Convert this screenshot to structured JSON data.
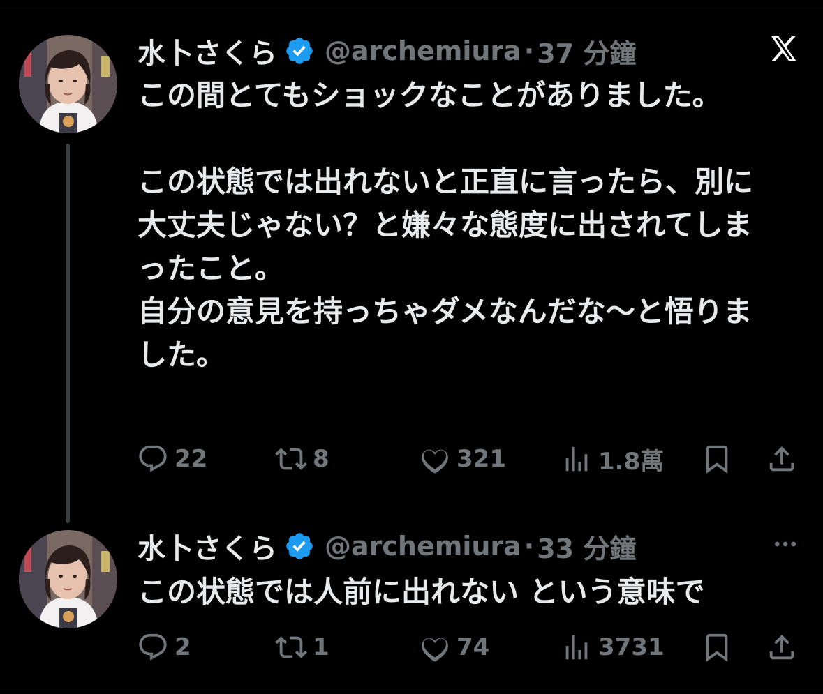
{
  "tweets": [
    {
      "author_name": "水卜さくら",
      "handle": "@archemiura",
      "separator": "·",
      "time": "37 分鐘",
      "text": "この間とてもショックなことがありました。\n\nこの状態では出れないと正直に言ったら、別に大丈夫じゃない？と嫌々な態度に出されてしまったこと。\n自分の意見を持っちゃダメなんだな〜と悟りました。",
      "replies": "22",
      "reposts": "8",
      "likes": "321",
      "views": "1.8萬"
    },
    {
      "author_name": "水卜さくら",
      "handle": "@archemiura",
      "separator": "·",
      "time": "33 分鐘",
      "text": "この状態では人前に出れない という意味で",
      "replies": "2",
      "reposts": "1",
      "likes": "74",
      "views": "3731"
    }
  ],
  "colors": {
    "background": "#000000",
    "text": "#e7e9ea",
    "secondary": "#71767b",
    "verified": "#1d9bf0"
  },
  "icons": {
    "brand": "x-logo-icon",
    "verified": "verified-badge-icon",
    "reply": "reply-icon",
    "repost": "repost-icon",
    "like": "heart-icon",
    "views": "views-icon",
    "bookmark": "bookmark-icon",
    "share": "share-icon",
    "more": "more-icon"
  }
}
